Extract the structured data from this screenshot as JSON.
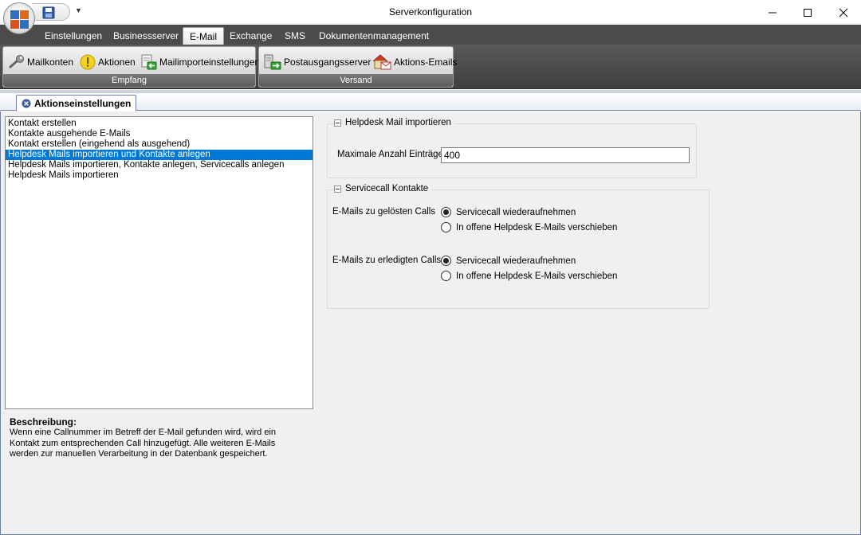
{
  "window": {
    "title": "Serverkonfiguration"
  },
  "ribbon": {
    "tabs": [
      {
        "label": "Einstellungen"
      },
      {
        "label": "Businessserver"
      },
      {
        "label": "E-Mail"
      },
      {
        "label": "Exchange"
      },
      {
        "label": "SMS"
      },
      {
        "label": "Dokumentenmanagement"
      }
    ],
    "active_tab": "E-Mail",
    "groups": [
      {
        "label": "Empfang",
        "buttons": [
          {
            "label": "Mailkonten",
            "icon": "wrench-icon"
          },
          {
            "label": "Aktionen",
            "icon": "warning-icon"
          },
          {
            "label": "Mailimporteinstellungen",
            "icon": "mail-import-icon"
          }
        ]
      },
      {
        "label": "Versand",
        "buttons": [
          {
            "label": "Postausgangsserver",
            "icon": "outgoing-server-icon"
          },
          {
            "label": "Aktions-Emails",
            "icon": "house-mail-icon"
          }
        ]
      }
    ]
  },
  "document_tab": {
    "label": "Aktionseinstellungen"
  },
  "actions_list": {
    "items": [
      "Kontakt erstellen",
      "Kontakte ausgehende E-Mails",
      "Kontakt erstellen (eingehend als ausgehend)",
      "Helpdesk Mails importieren und Kontakte anlegen",
      "Helpdesk Mails importieren, Kontakte anlegen, Servicecalls anlegen",
      "Helpdesk Mails importieren"
    ],
    "selected_index": 3
  },
  "description": {
    "title": "Beschreibung:",
    "text": "Wenn eine Callnummer im Betreff der E-Mail gefunden wird, wird ein Kontakt zum entsprechenden Call hinzugefügt. Alle weiteren E-Mails werden zur manuellen Verarbeitung in der Datenbank gespeichert."
  },
  "helpdesk_group": {
    "title": "Helpdesk Mail importieren",
    "max_entries_label": "Maximale Anzahl Einträge",
    "max_entries_value": "400"
  },
  "servicecall_group": {
    "title": "Servicecall Kontakte",
    "solved": {
      "label": "E-Mails zu gelösten Calls",
      "options": [
        "Servicecall wiederaufnehmen",
        "In offene Helpdesk E-Mails verschieben"
      ],
      "selected": 0
    },
    "done": {
      "label": "E-Mails zu erledigten Calls",
      "options": [
        "Servicecall wiederaufnehmen",
        "In offene Helpdesk E-Mails verschieben"
      ],
      "selected": 0
    }
  },
  "colors": {
    "selection": "#0078d7",
    "ribbon_dark": "#4b4b4b"
  }
}
